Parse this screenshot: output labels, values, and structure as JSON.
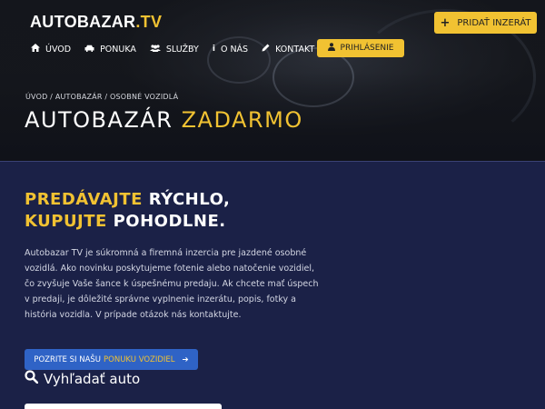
{
  "brand": {
    "name": "AUTOBAZAR",
    "suffix": ".TV"
  },
  "header": {
    "add_button": "PRIDAŤ INZERÁT",
    "login_button": "PRIHLÁSENIE"
  },
  "nav": {
    "items": [
      {
        "label": "ÚVOD",
        "icon": "home-icon"
      },
      {
        "label": "PONUKA",
        "icon": "car-icon"
      },
      {
        "label": "SLUŽBY",
        "icon": "users-icon"
      },
      {
        "label": "O NÁS",
        "icon": "info-icon"
      },
      {
        "label": "KONTAKT",
        "icon": "pencil-icon"
      }
    ]
  },
  "breadcrumb": "ÚVOD / AUTOBAZÁR / OSOBNÉ VOZIDLÁ",
  "title": {
    "part1": "AUTOBAZÁR",
    "part2": "ZADARMO"
  },
  "intro": {
    "line1_accent": "PREDÁVAJTE",
    "line1_rest": "RÝCHLO,",
    "line2_accent": "KUPUJTE",
    "line2_rest": "POHODLNE.",
    "paragraph": "Autobazar TV je súkromná a firemná inzercia pre jazdené osobné vozidlá. Ako novinku poskytujeme fotenie alebo natočenie vozidiel, čo zvyšuje Vaše šance k úspešnému predaju. Ak chcete mať úspech v predaji, je dôležité správne vyplnenie inzerátu, popis, fotky a história vozidla. V prípade otázok nás kontaktujte."
  },
  "offer_button": {
    "prefix": "POZRITE SI NAŠU",
    "accent": "PONUKU VOZIDIEL"
  },
  "search": {
    "title": "Vyhľadať auto"
  },
  "colors": {
    "accent": "#f1c232",
    "background": "#1b2147",
    "button_blue": "#2f63c6"
  }
}
